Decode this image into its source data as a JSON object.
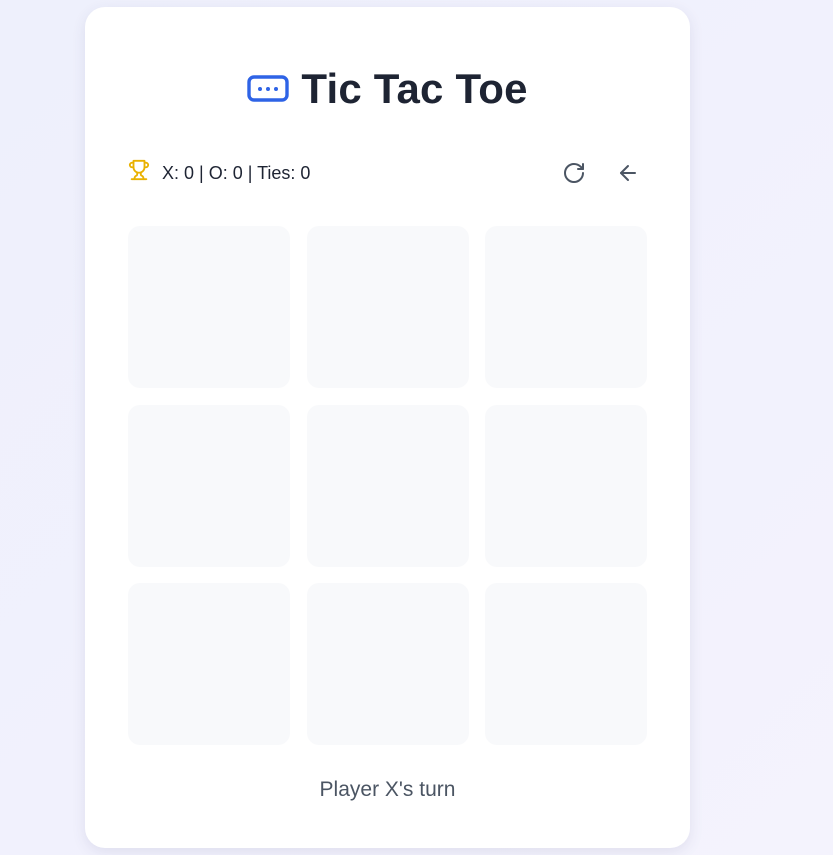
{
  "header": {
    "title": "Tic Tac Toe",
    "icon": "gamepad-icon"
  },
  "scoreboard": {
    "icon": "trophy-icon",
    "text": "X: 0 | O: 0 | Ties: 0",
    "x_wins": 0,
    "o_wins": 0,
    "ties": 0
  },
  "actions": {
    "restart_icon": "restart-icon",
    "back_icon": "arrow-left-icon"
  },
  "board": {
    "cells": [
      "",
      "",
      "",
      "",
      "",
      "",
      "",
      "",
      ""
    ]
  },
  "status": {
    "text": "Player X's turn"
  },
  "colors": {
    "accent": "#2e63e6",
    "trophy": "#e9b100",
    "title": "#1e2433",
    "cell_bg": "#f8f9fb",
    "status": "#4b5563"
  }
}
